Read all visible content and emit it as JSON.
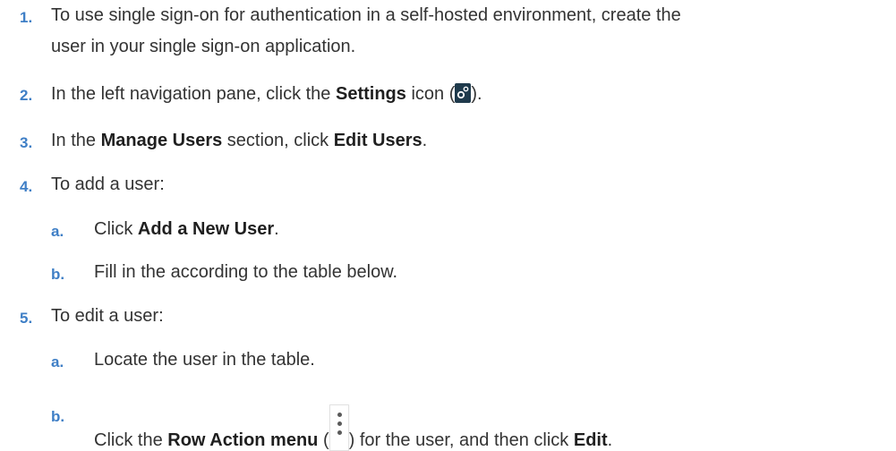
{
  "steps": {
    "s1": {
      "num": "1.",
      "line1": "To use single sign-on for authentication in a self-hosted environment, create the",
      "line2": "user in your single sign-on application."
    },
    "s2": {
      "num": "2.",
      "pre": "In the left navigation pane, click the ",
      "bold": "Settings",
      "mid": " icon (",
      "post": ")."
    },
    "s3": {
      "num": "3.",
      "pre": "In the ",
      "bold1": "Manage Users",
      "mid": " section, click ",
      "bold2": "Edit Users",
      "post": "."
    },
    "s4": {
      "num": "4.",
      "text": "To add a user:",
      "a": {
        "num": "a.",
        "pre": "Click ",
        "bold": "Add a New User",
        "post": "."
      },
      "b": {
        "num": "b.",
        "text": "Fill in the according to the table below."
      }
    },
    "s5": {
      "num": "5.",
      "text": "To edit a user:",
      "a": {
        "num": "a.",
        "text": "Locate the user in the table."
      },
      "b": {
        "num": "b.",
        "pre": "Click the ",
        "bold1": "Row Action menu",
        "mid1": " (",
        "mid2": ") for the user, and then click ",
        "bold2": "Edit",
        "post": "."
      }
    }
  },
  "icons": {
    "settings": "settings-gear-icon",
    "row_action": "vertical-ellipsis-icon"
  },
  "colors": {
    "number": "#3f7fc6",
    "text": "#333333",
    "settings_icon_bg": "#1f3a4c"
  }
}
